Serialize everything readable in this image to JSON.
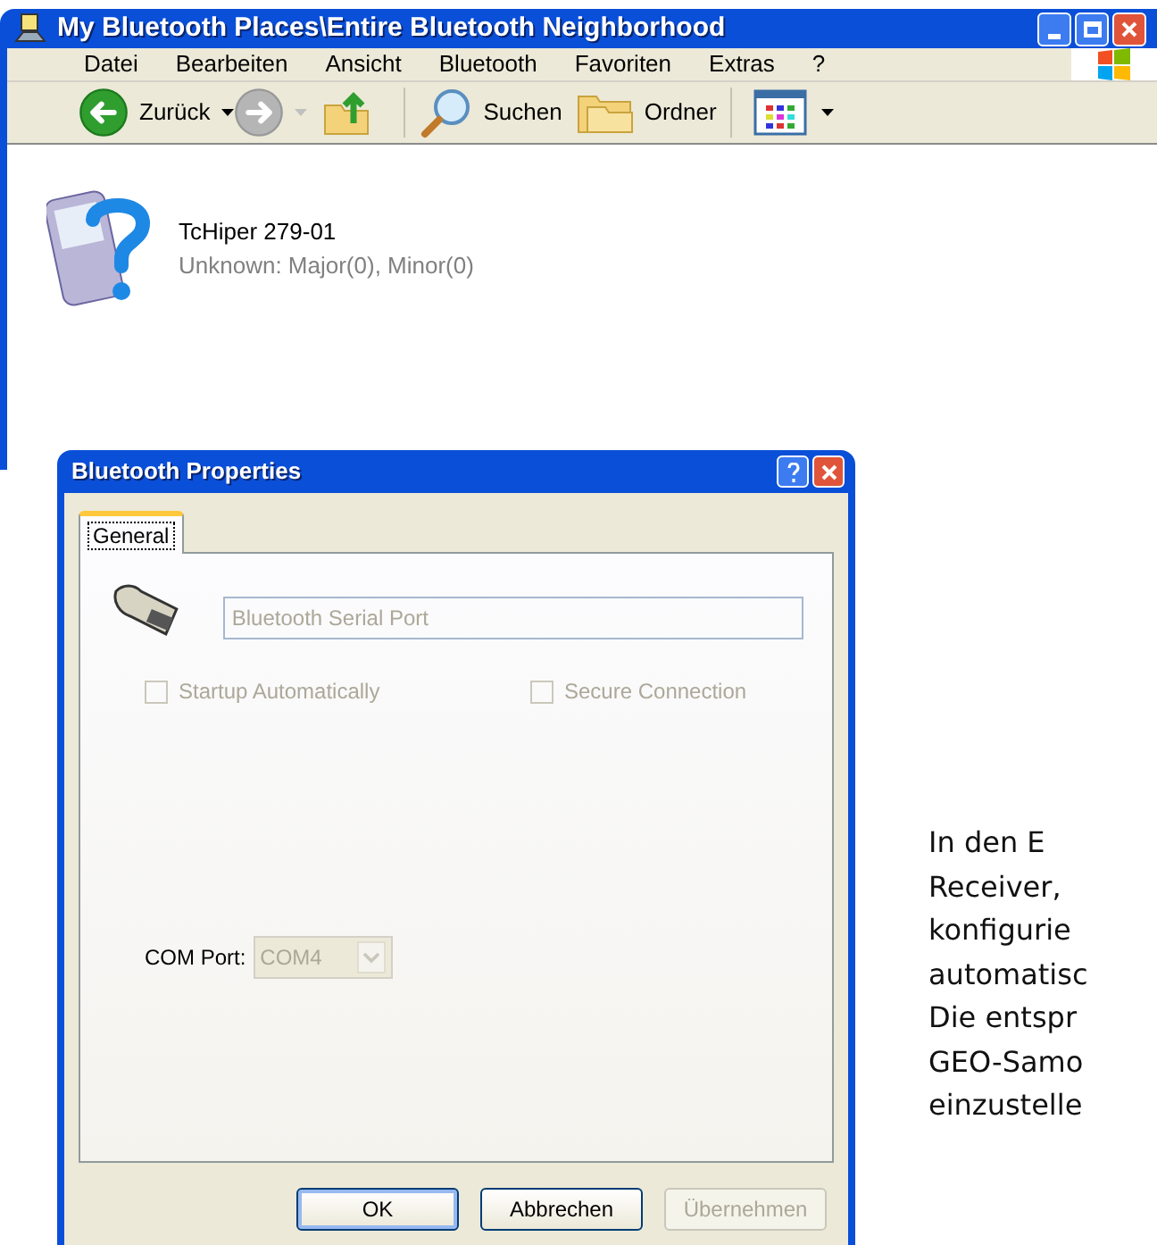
{
  "explorer": {
    "title": "My Bluetooth Places\\Entire Bluetooth Neighborhood",
    "menu": [
      "Datei",
      "Bearbeiten",
      "Ansicht",
      "Bluetooth",
      "Favoriten",
      "Extras",
      "?"
    ],
    "toolbar": [
      {
        "kind": "back",
        "label": "Zurück",
        "disabled": false
      },
      {
        "kind": "forward",
        "disabled": true
      },
      {
        "kind": "up"
      },
      {
        "kind": "search",
        "label": "Suchen"
      },
      {
        "kind": "folders",
        "label": "Ordner"
      },
      {
        "kind": "views"
      }
    ],
    "devices": [
      {
        "name": "TcHiper 279-01",
        "info": "Unknown: Major(0), Minor(0)"
      }
    ]
  },
  "dialog": {
    "title": "Bluetooth Properties",
    "tabs": [
      {
        "label": "General",
        "selected": true
      }
    ],
    "service_name": {
      "value": "Bluetooth Serial Port",
      "disabled": true
    },
    "options": [
      {
        "label": "Startup Automatically",
        "checked": false,
        "disabled": true
      },
      {
        "label": "Secure Connection",
        "checked": false,
        "disabled": true
      }
    ],
    "com_port": {
      "label": "COM Port:",
      "value": "COM4",
      "disabled": true
    },
    "buttons": [
      {
        "label": "OK",
        "disabled": false
      },
      {
        "label": "Abbrechen",
        "disabled": false
      },
      {
        "label": "Übernehmen",
        "disabled": true
      }
    ]
  },
  "paragraph_lines": [
    "In den E",
    "Receiver,",
    "konfigurie",
    "automatisc",
    "Die entspr",
    "GEO-Samo",
    "einzustelle"
  ]
}
